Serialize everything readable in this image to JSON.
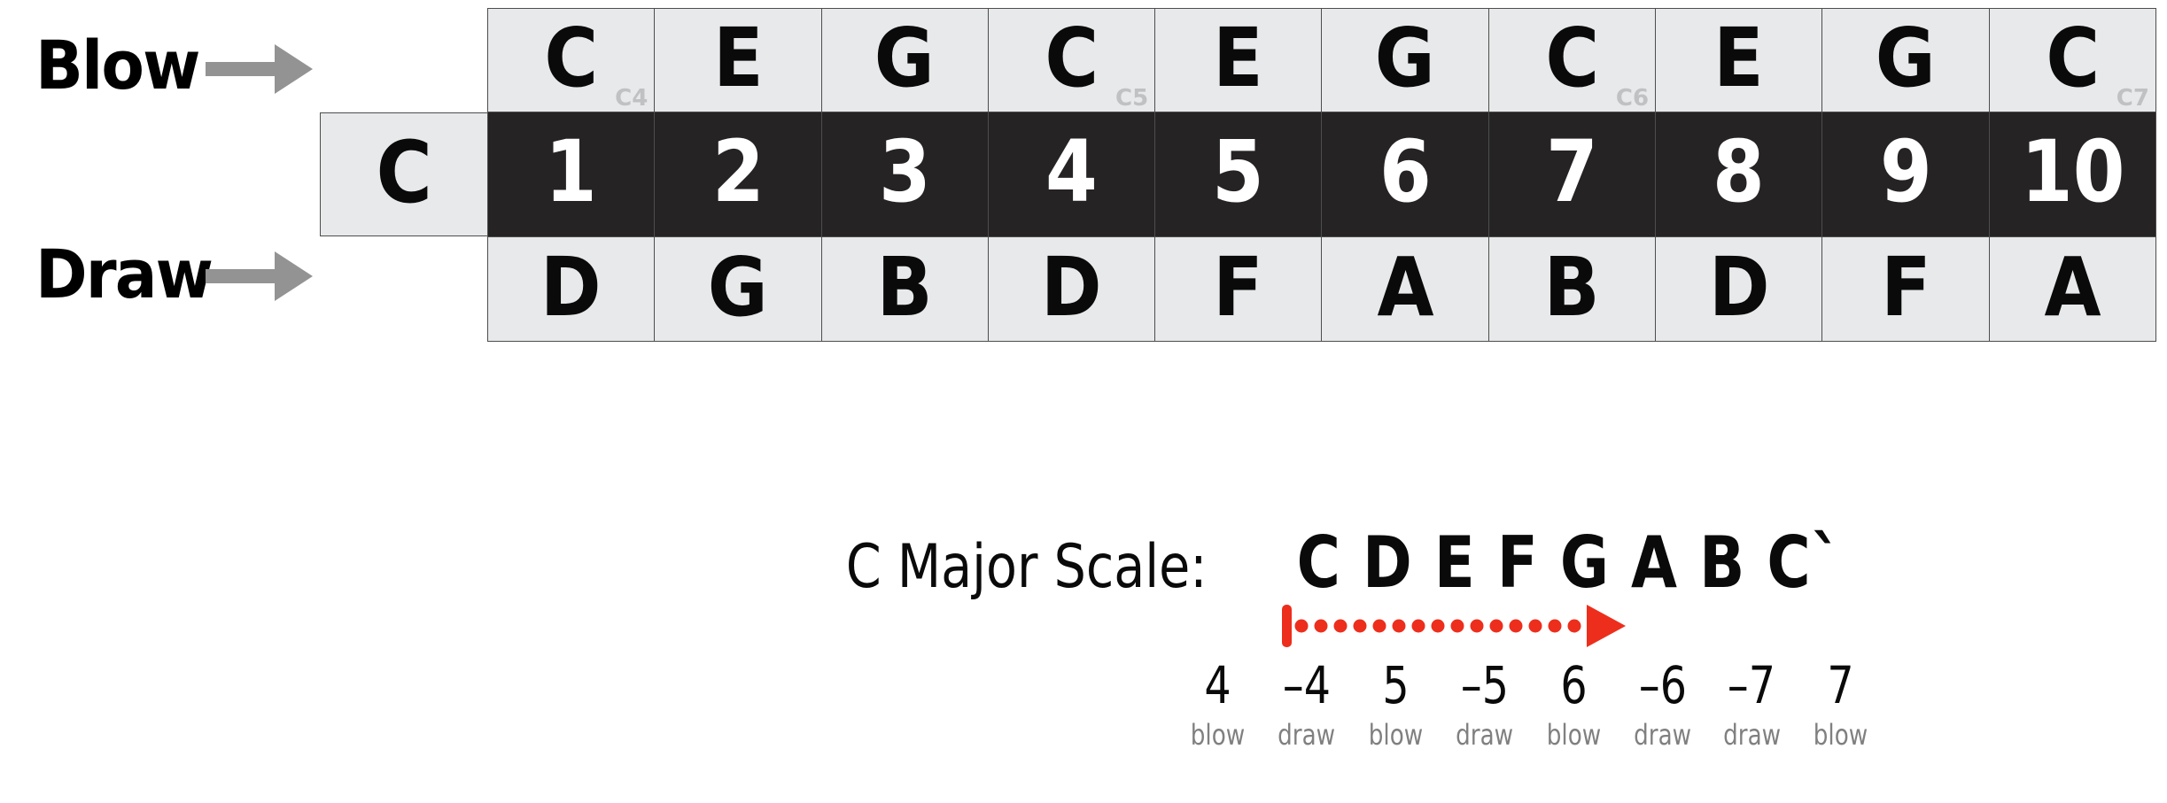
{
  "labels": {
    "blow": "Blow",
    "draw": "Draw",
    "blow_arrow_icon": "right-arrow-icon",
    "draw_arrow_icon": "right-arrow-icon"
  },
  "key_cell": {
    "label": "C"
  },
  "harmonica": {
    "holes": [
      "1",
      "2",
      "3",
      "4",
      "5",
      "6",
      "7",
      "8",
      "9",
      "10"
    ],
    "blow_notes": [
      "C",
      "E",
      "G",
      "C",
      "E",
      "G",
      "C",
      "E",
      "G",
      "C"
    ],
    "blow_octaves": [
      "C4",
      "",
      "",
      "C5",
      "",
      "",
      "C6",
      "",
      "",
      "C7"
    ],
    "draw_notes": [
      "D",
      "G",
      "B",
      "D",
      "F",
      "A",
      "B",
      "D",
      "F",
      "A"
    ]
  },
  "caption": {
    "scale_title": "C Major Scale:",
    "scale_notes": "C D E F G A B C`",
    "arrow_icon": "red-dotted-right-arrow-icon",
    "arrow_color": "#ED2E1C",
    "tabs": [
      {
        "number": "4",
        "breath": "blow"
      },
      {
        "number": "–4",
        "breath": "draw"
      },
      {
        "number": "5",
        "breath": "blow"
      },
      {
        "number": "–5",
        "breath": "draw"
      },
      {
        "number": "6",
        "breath": "blow"
      },
      {
        "number": "–6",
        "breath": "draw"
      },
      {
        "number": "–7",
        "breath": "draw"
      },
      {
        "number": "7",
        "breath": "blow"
      }
    ]
  },
  "colors": {
    "cell_background": "#E7E9EA",
    "cell_border": "#4D4D4D",
    "number_row_background": "#262324",
    "number_text": "#FFFFFF",
    "note_text": "#0A0A0A",
    "octave_tag": "#BFC1C2",
    "arrow_gray": "#939393",
    "breath_label": "#808080",
    "accent_red": "#ED2E1C"
  }
}
